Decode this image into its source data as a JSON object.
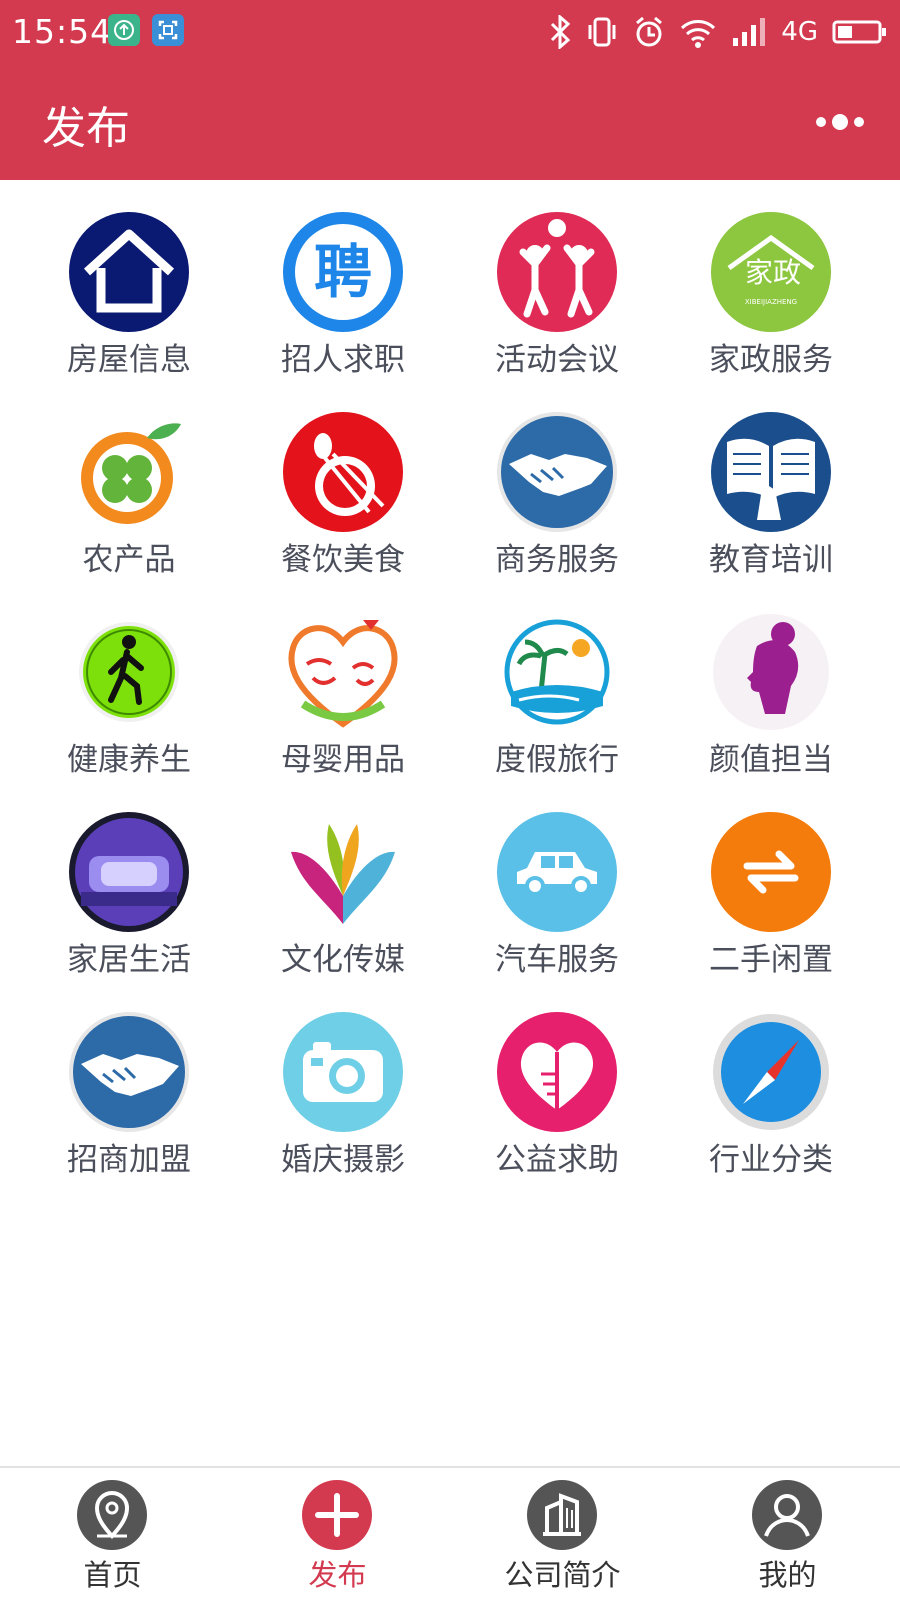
{
  "status_bar": {
    "time": "15:54",
    "network": "4G"
  },
  "header": {
    "title": "发布"
  },
  "colors": {
    "brand": "#d33a4f",
    "label": "#4b4f5b",
    "tab_inactive": "#555555"
  },
  "categories": [
    {
      "label": "房屋信息",
      "icon": "house-icon"
    },
    {
      "label": "招人求职",
      "icon": "recruit-icon"
    },
    {
      "label": "活动会议",
      "icon": "activity-icon"
    },
    {
      "label": "家政服务",
      "icon": "housekeeping-icon"
    },
    {
      "label": "农产品",
      "icon": "produce-icon"
    },
    {
      "label": "餐饮美食",
      "icon": "dining-icon"
    },
    {
      "label": "商务服务",
      "icon": "handshake-icon"
    },
    {
      "label": "教育培训",
      "icon": "book-icon"
    },
    {
      "label": "健康养生",
      "icon": "walking-icon"
    },
    {
      "label": "母婴用品",
      "icon": "maternal-icon"
    },
    {
      "label": "度假旅行",
      "icon": "island-icon"
    },
    {
      "label": "颜值担当",
      "icon": "beauty-icon"
    },
    {
      "label": "家居生活",
      "icon": "bed-icon"
    },
    {
      "label": "文化传媒",
      "icon": "culture-icon"
    },
    {
      "label": "汽车服务",
      "icon": "car-icon"
    },
    {
      "label": "二手闲置",
      "icon": "swap-icon"
    },
    {
      "label": "招商加盟",
      "icon": "partnership-icon"
    },
    {
      "label": "婚庆摄影",
      "icon": "camera-icon"
    },
    {
      "label": "公益求助",
      "icon": "charity-heart-icon"
    },
    {
      "label": "行业分类",
      "icon": "compass-icon"
    }
  ],
  "tabbar": {
    "items": [
      {
        "label": "首页",
        "icon": "location-pin-icon",
        "active": false
      },
      {
        "label": "发布",
        "icon": "plus-icon",
        "active": true
      },
      {
        "label": "公司简介",
        "icon": "building-icon",
        "active": false
      },
      {
        "label": "我的",
        "icon": "user-icon",
        "active": false
      }
    ]
  },
  "recruit_glyph": "聘",
  "housekeeping_glyph": "家政",
  "housekeeping_subtext": "XIBEIJIAZHENG"
}
